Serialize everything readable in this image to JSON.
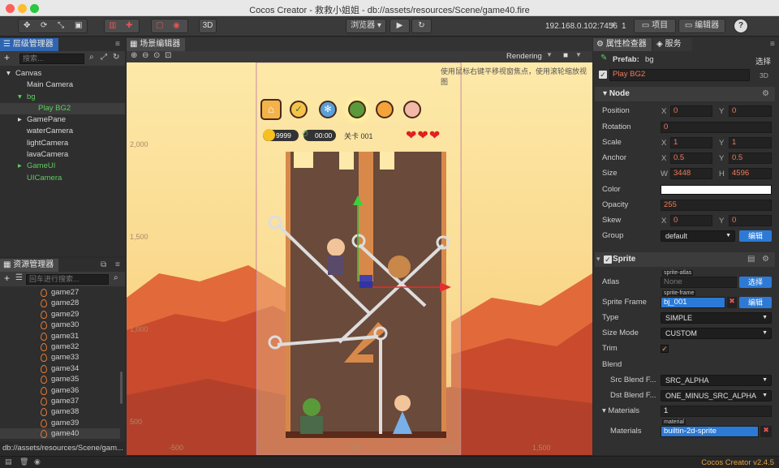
{
  "titlebar": {
    "title": "Cocos Creator - 救救小姐姐 - db://assets/resources/Scene/game40.fire"
  },
  "toolbar": {
    "mode_3d": "3D",
    "preview_select": "浏览器 ▾",
    "ip": "192.168.0.102:7456",
    "wifi": "⚡",
    "count": "1",
    "project_btn": "项目",
    "editor_btn": "编辑器",
    "help": "?"
  },
  "hierarchy": {
    "tab": "层级管理器",
    "search_placeholder": "搜索...",
    "nodes": [
      {
        "label": "Canvas",
        "depth": 0,
        "arrow": "▾",
        "color": "#d8d8d8"
      },
      {
        "label": "Main Camera",
        "depth": 1,
        "arrow": "",
        "color": "#d8d8d8"
      },
      {
        "label": "bg",
        "depth": 1,
        "arrow": "▾",
        "color": "#5ccd5c"
      },
      {
        "label": "Play BG2",
        "depth": 2,
        "arrow": "",
        "color": "#5ccd5c"
      },
      {
        "label": "GamePane",
        "depth": 1,
        "arrow": "▸",
        "color": "#d8d8d8"
      },
      {
        "label": "waterCamera",
        "depth": 1,
        "arrow": "",
        "color": "#d8d8d8"
      },
      {
        "label": "lightCamera",
        "depth": 1,
        "arrow": "",
        "color": "#d8d8d8"
      },
      {
        "label": "lavaCamera",
        "depth": 1,
        "arrow": "",
        "color": "#d8d8d8"
      },
      {
        "label": "GameUI",
        "depth": 1,
        "arrow": "▸",
        "color": "#5ccd5c"
      },
      {
        "label": "UICamera",
        "depth": 1,
        "arrow": "",
        "color": "#5ccd5c"
      }
    ]
  },
  "assets": {
    "tab": "资源管理器",
    "search_placeholder": "回车进行搜索...",
    "items": [
      "game27",
      "game28",
      "game29",
      "game30",
      "game31",
      "game32",
      "game33",
      "game34",
      "game35",
      "game36",
      "game37",
      "game38",
      "game39",
      "game40"
    ],
    "path": "db://assets/resources/Scene/gam..."
  },
  "scene": {
    "tab": "场景编辑器",
    "hint": "使用鼠标右键平移视窗焦点，使用滚轮缩放视图",
    "rendering": "Rendering",
    "y_ticks": [
      "2,000",
      "1,500",
      "1,000",
      "500"
    ],
    "x_ticks": [
      "-500",
      "0",
      "500",
      "1,000",
      "1,500"
    ],
    "game": {
      "coins": "9999",
      "timer": "00:00",
      "level": "关卡 001"
    }
  },
  "inspector": {
    "tab": "属性检查器",
    "tab2": "服务",
    "prefab_label": "Prefab:",
    "prefab_name": "bg",
    "select": "选择",
    "node_name": "Play BG2",
    "mode": "3D",
    "node": {
      "title": "Node",
      "position_label": "Position",
      "pos_x": "0",
      "pos_y": "0",
      "rotation_label": "Rotation",
      "rotation": "0",
      "scale_label": "Scale",
      "scale_x": "1",
      "scale_y": "1",
      "anchor_label": "Anchor",
      "anchor_x": "0.5",
      "anchor_y": "0.5",
      "size_label": "Size",
      "size_w": "3448",
      "size_h": "4596",
      "color_label": "Color",
      "opacity_label": "Opacity",
      "opacity": "255",
      "skew_label": "Skew",
      "skew_x": "0",
      "skew_y": "0",
      "group_label": "Group",
      "group": "default",
      "edit": "编辑",
      "x": "X",
      "y": "Y",
      "w": "W",
      "h": "H"
    },
    "sprite": {
      "title": "Sprite",
      "atlas_label": "Atlas",
      "atlas_tag": "sprite-atlas",
      "atlas_value": "None",
      "select": "选择",
      "frame_label": "Sprite Frame",
      "frame_tag": "sprite-frame",
      "frame_value": "bj_001",
      "edit": "编辑",
      "type_label": "Type",
      "type": "SIMPLE",
      "size_mode_label": "Size Mode",
      "size_mode": "CUSTOM",
      "trim_label": "Trim",
      "blend_label": "Blend",
      "src_label": "Src Blend F...",
      "src": "SRC_ALPHA",
      "dst_label": "Dst Blend F...",
      "dst": "ONE_MINUS_SRC_ALPHA",
      "materials_label": "Materials",
      "materials_count": "1",
      "material_label": "Materials",
      "material_tag": "material",
      "material_value": "builtin-2d-sprite"
    }
  },
  "status": {
    "version": "Cocos Creator v2.4.5"
  }
}
